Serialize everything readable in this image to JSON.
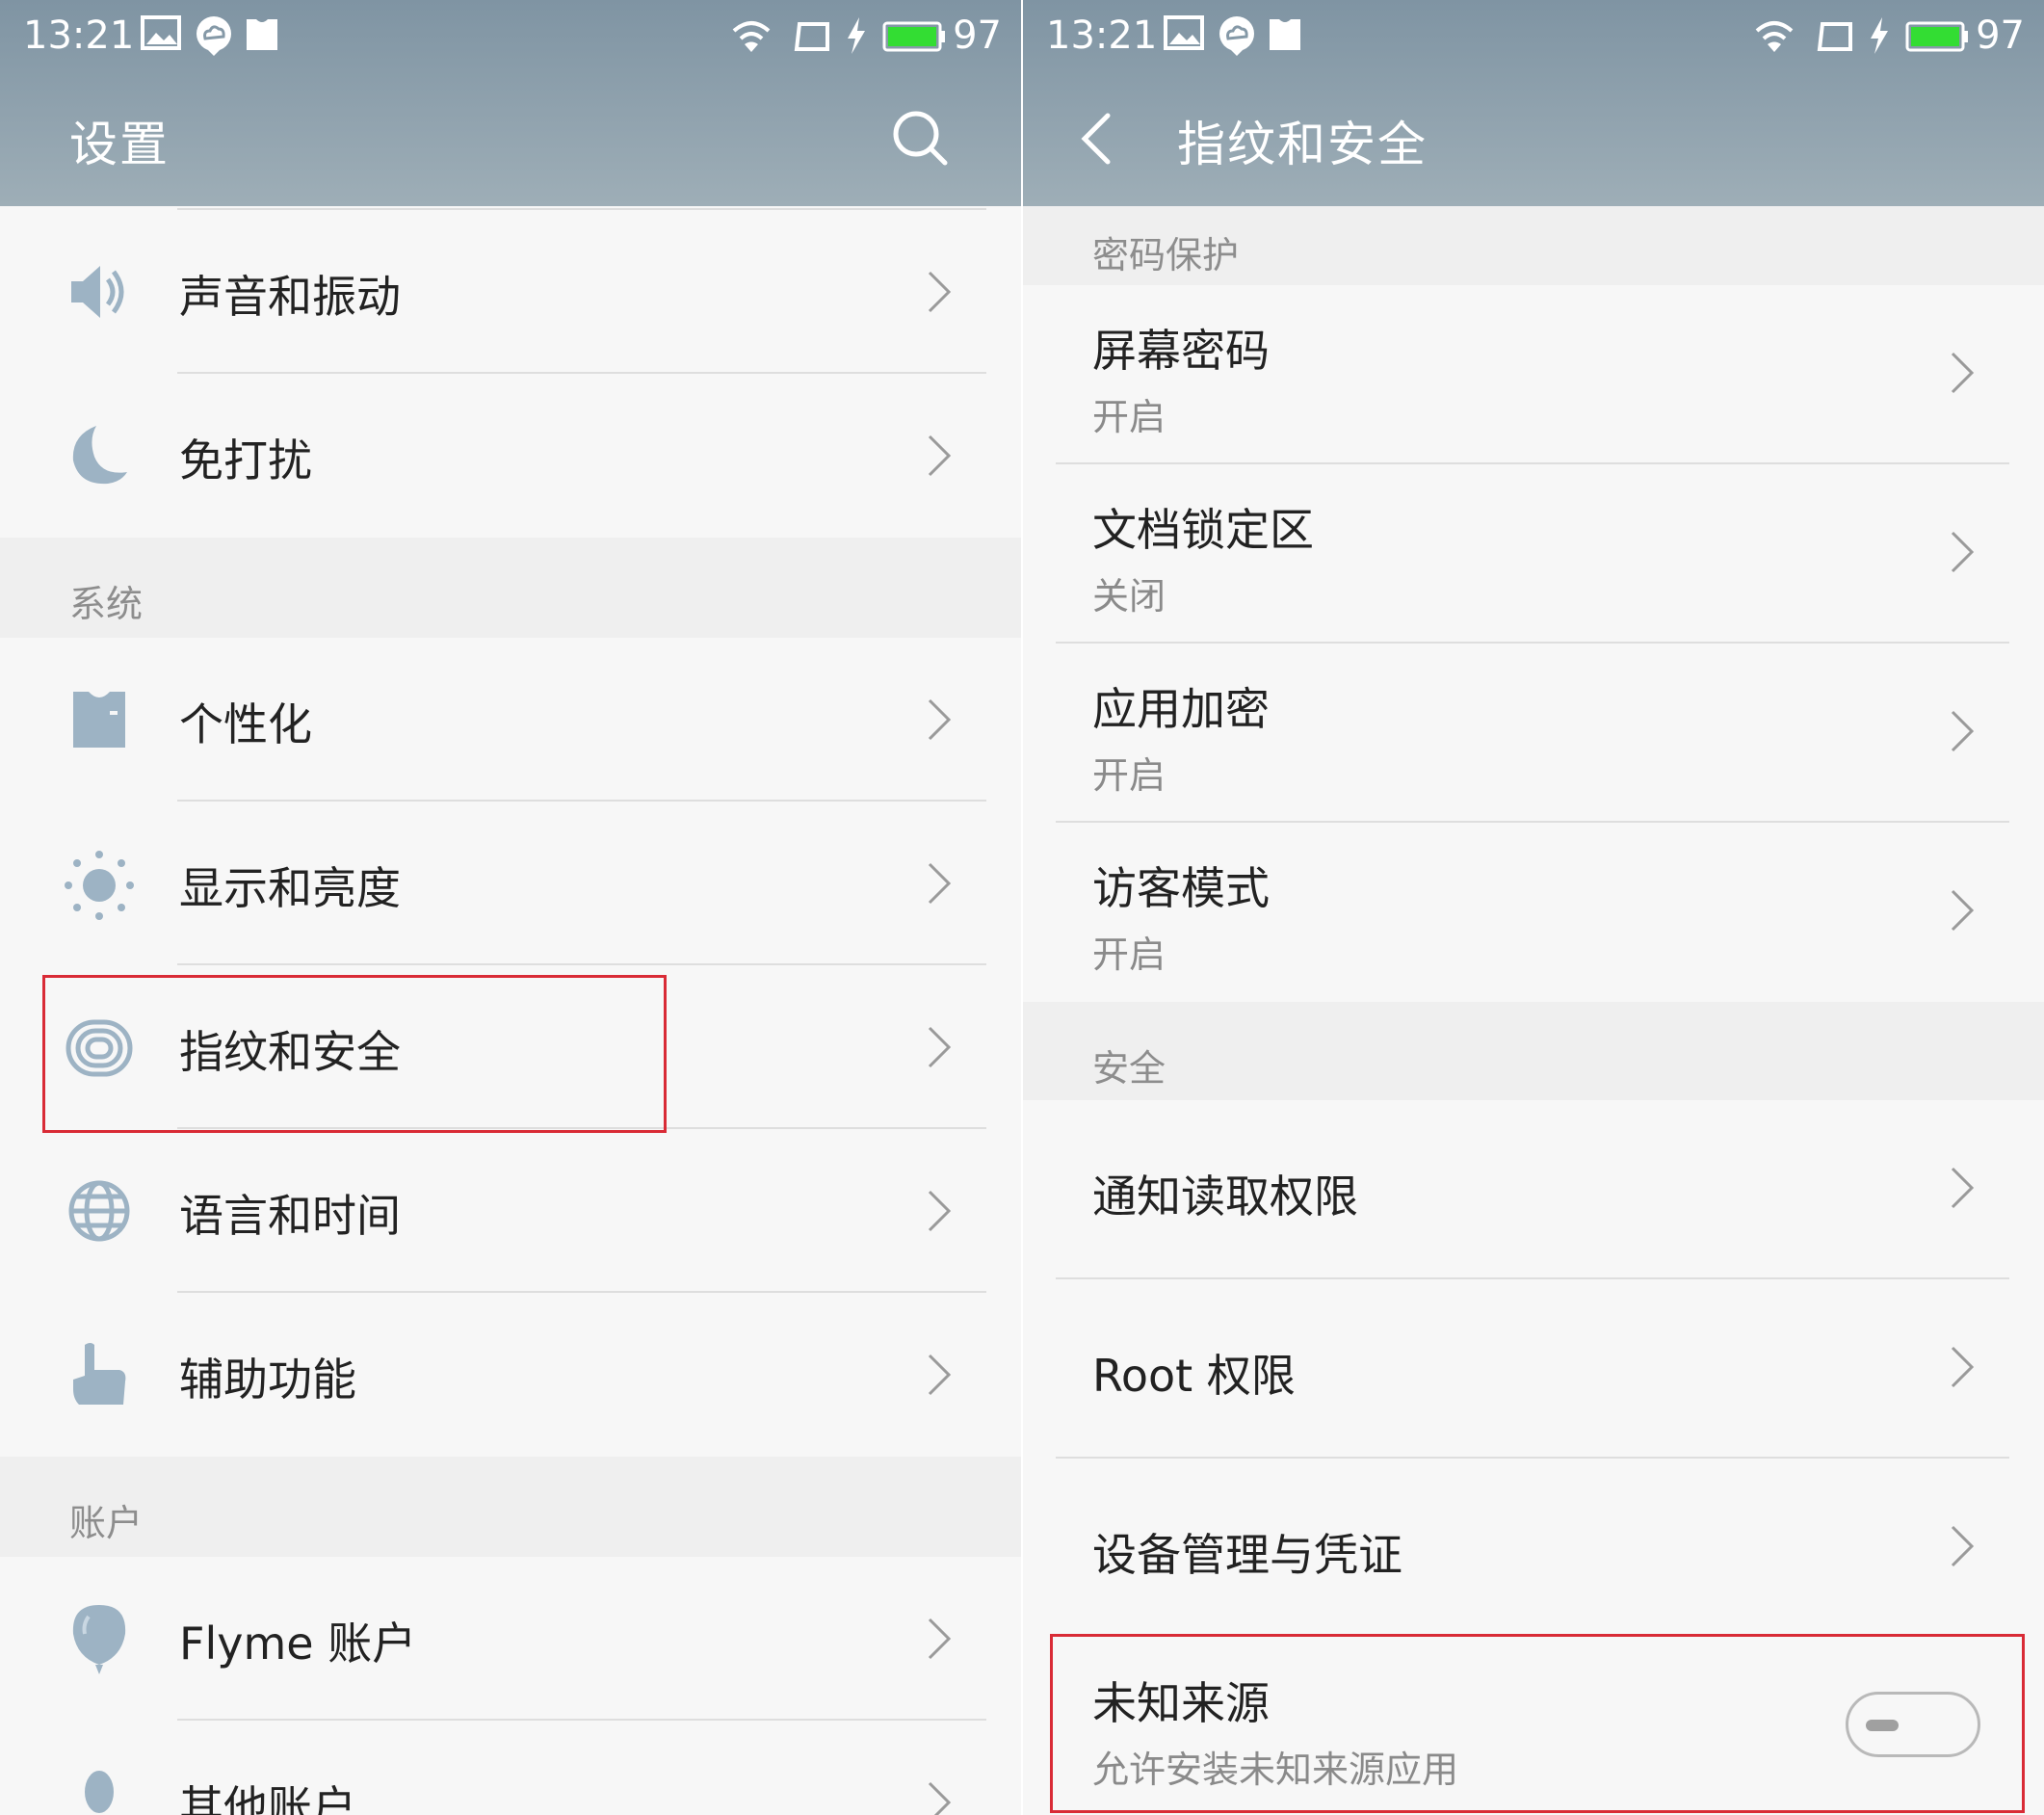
{
  "status_bar": {
    "time": "13:21",
    "battery": "97"
  },
  "left": {
    "title": "设置",
    "top_items": [
      {
        "label": "声音和振动",
        "icon": "speaker-icon"
      },
      {
        "label": "免打扰",
        "icon": "moon-icon"
      }
    ],
    "section_system": "系统",
    "system_items": [
      {
        "label": "个性化",
        "icon": "shirt-icon"
      },
      {
        "label": "显示和亮度",
        "icon": "sun-icon"
      },
      {
        "label": "指纹和安全",
        "icon": "fingerprint-icon"
      },
      {
        "label": "语言和时间",
        "icon": "globe-icon"
      },
      {
        "label": "辅助功能",
        "icon": "hand-pointer-icon"
      }
    ],
    "section_account": "账户",
    "account_items": [
      {
        "label": "Flyme 账户",
        "icon": "balloon-icon"
      },
      {
        "label": "其他账户",
        "icon": "account-icon"
      }
    ]
  },
  "right": {
    "title": "指纹和安全",
    "section_password": "密码保护",
    "password_items": [
      {
        "label": "屏幕密码",
        "sub": "开启"
      },
      {
        "label": "文档锁定区",
        "sub": "关闭"
      },
      {
        "label": "应用加密",
        "sub": "开启"
      },
      {
        "label": "访客模式",
        "sub": "开启"
      }
    ],
    "section_security": "安全",
    "security_items": [
      {
        "label": "通知读取权限"
      },
      {
        "label": "Root 权限"
      },
      {
        "label": "设备管理与凭证"
      }
    ],
    "unknown_sources": {
      "label": "未知来源",
      "sub": "允许安装未知来源应用",
      "enabled": false
    }
  },
  "colors": {
    "accent_bar": "#8a9eab",
    "highlight": "#d92b36",
    "icon": "#9db3c4"
  }
}
